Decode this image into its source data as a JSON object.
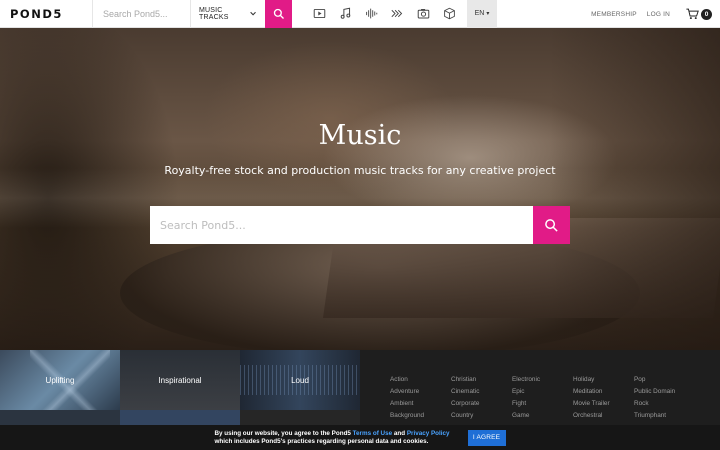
{
  "header": {
    "logo": "POND5",
    "search_placeholder": "Search Pond5...",
    "category": "MUSIC TRACKS",
    "media_icons": [
      "video-icon",
      "music-icon",
      "sound-effects-icon",
      "after-effects-icon",
      "photo-icon",
      "3d-icon"
    ],
    "language": "EN",
    "membership": "MEMBERSHIP",
    "login": "LOG IN",
    "cart_count": "0"
  },
  "hero": {
    "title": "Music",
    "subtitle": "Royalty-free stock and production music tracks for any creative project",
    "search_placeholder": "Search Pond5..."
  },
  "tiles": [
    {
      "label": "Uplifting"
    },
    {
      "label": "Inspirational"
    },
    {
      "label": "Loud"
    }
  ],
  "genres": [
    [
      "Action",
      "Adventure",
      "Ambient",
      "Background"
    ],
    [
      "Christian",
      "Cinematic",
      "Corporate",
      "Country"
    ],
    [
      "Electronic",
      "Epic",
      "Fight",
      "Game"
    ],
    [
      "Holiday",
      "Meditation",
      "Movie Trailer",
      "Orchestral"
    ],
    [
      "Pop",
      "Public Domain",
      "Rock",
      "Triumphant"
    ]
  ],
  "cookie": {
    "text_before": "By using our website, you agree to the Pond5 ",
    "terms": "Terms of Use",
    "and": " and ",
    "privacy": "Privacy Policy",
    "line2": "which includes Pond5's practices regarding personal data and cookies.",
    "button": "I AGREE"
  },
  "colors": {
    "accent": "#e11b87",
    "agree_button": "#1f6fd6"
  }
}
